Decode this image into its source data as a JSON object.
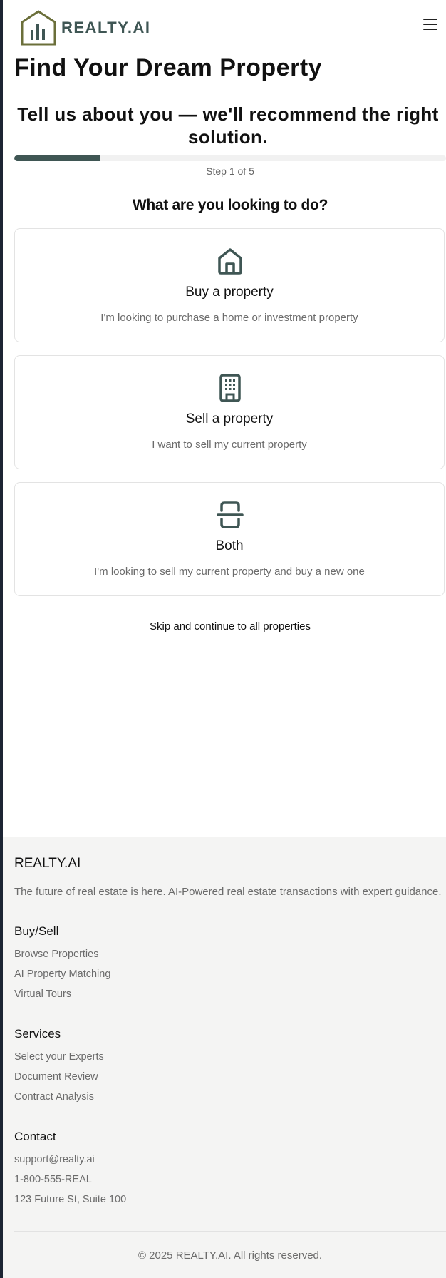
{
  "header": {
    "brand": "REALTY.AI",
    "menu_icon": "hamburger-icon"
  },
  "page_title": "Find Your Dream Property",
  "intro": "Tell us about you — we'll recommend the right solution.",
  "progress": {
    "step_text": "Step 1 of 5",
    "fraction": 0.2
  },
  "question": "What are you looking to do?",
  "options": [
    {
      "title": "Buy a property",
      "description": "I'm looking to purchase a home or investment property",
      "icon": "home-icon"
    },
    {
      "title": "Sell a property",
      "description": "I want to sell my current property",
      "icon": "building-icon"
    },
    {
      "title": "Both",
      "description": "I'm looking to sell my current property and buy a new one",
      "icon": "split-icon"
    }
  ],
  "skip_link": "Skip and continue to all properties",
  "footer": {
    "brand": "REALTY.AI",
    "tagline": "The future of real estate is here. AI-Powered real estate transactions with expert guidance.",
    "sections": [
      {
        "heading": "Buy/Sell",
        "links": [
          "Browse Properties",
          "AI Property Matching",
          "Virtual Tours"
        ]
      },
      {
        "heading": "Services",
        "links": [
          "Select your Experts",
          "Document Review",
          "Contract Analysis"
        ]
      },
      {
        "heading": "Contact",
        "links": [
          "support@realty.ai",
          "1-800-555-REAL",
          "123 Future St, Suite 100"
        ]
      }
    ],
    "copyright": "© 2025 REALTY.AI. All rights reserved."
  },
  "colors": {
    "accent": "#3f5654",
    "logo_olive": "#6b6f3a",
    "footer_bg": "#f4f4f3"
  }
}
